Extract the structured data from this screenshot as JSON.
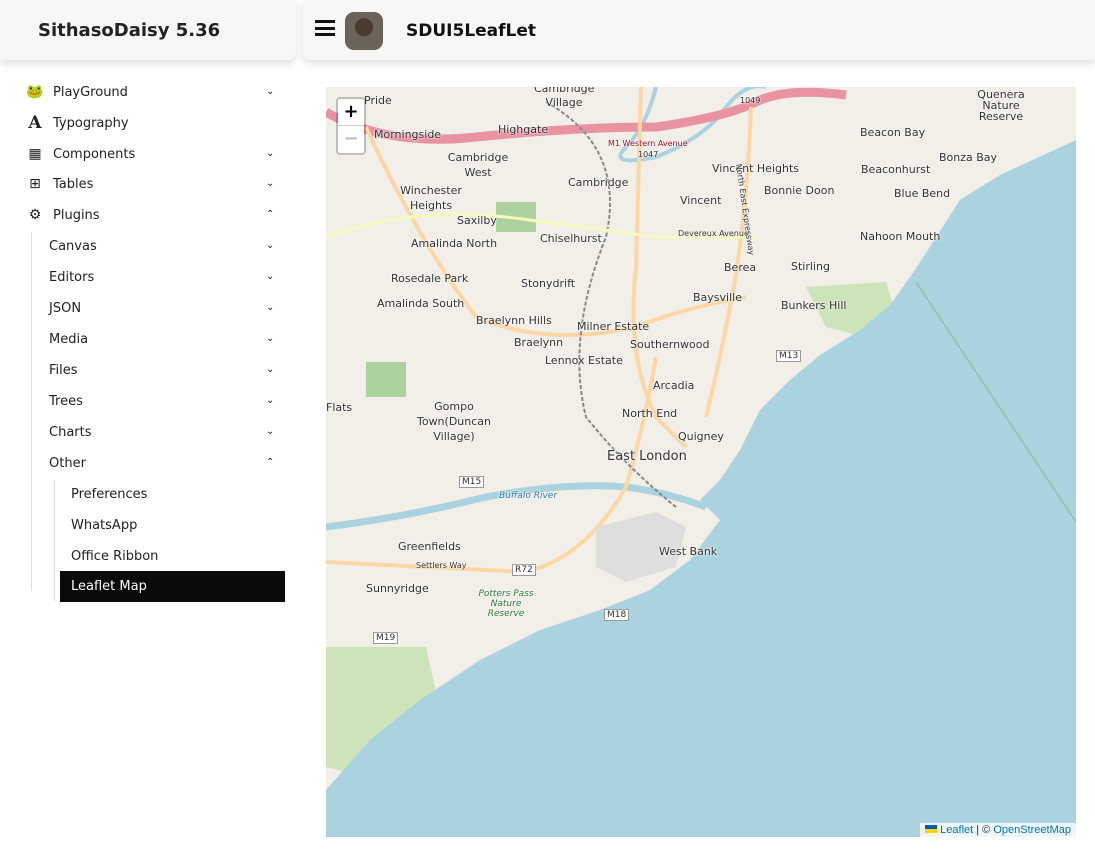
{
  "header": {
    "brand": "SithasoDaisy 5.36",
    "app_title": "SDUI5LeafLet"
  },
  "sidebar": {
    "items": [
      {
        "label": "PlayGround",
        "icon": "playground-icon"
      },
      {
        "label": "Typography",
        "icon": "typography-icon"
      },
      {
        "label": "Components",
        "icon": "gifts-icon"
      },
      {
        "label": "Tables",
        "icon": "table-icon"
      },
      {
        "label": "Plugins",
        "icon": "gears-icon"
      }
    ],
    "plugins": [
      "Canvas",
      "Editors",
      "JSON",
      "Media",
      "Files",
      "Trees",
      "Charts",
      "Other"
    ],
    "other": [
      "Preferences",
      "WhatsApp",
      "Office Ribbon",
      "Leaflet Map"
    ]
  },
  "map": {
    "zoom_in": "+",
    "zoom_out": "−",
    "attribution": {
      "leaflet": "Leaflet",
      "sep": " | © ",
      "osm": "OpenStreetMap"
    },
    "labels": {
      "pride": "Pride",
      "cambridge_village": "Cambridge Village",
      "morningside": "Morningside",
      "highgate": "Highgate",
      "m1": "M1 Western Avenue",
      "n1047": "1047",
      "n1049": "1049",
      "cambridge_west": "Cambridge West",
      "cambridge": "Cambridge",
      "vincent_heights": "Vincent Heights",
      "bonnie_doon": "Bonnie Doon",
      "beacon_bay": "Beacon Bay",
      "beaconhurst": "Beaconhurst",
      "bonza_bay": "Bonza Bay",
      "blue_bend": "Blue Bend",
      "winchester": "Winchester Heights",
      "saxilby": "Saxilby",
      "vincent": "Vincent",
      "chiselhurst": "Chiselhurst",
      "amalinda_north": "Amalinda North",
      "nahoon_mouth": "Nahoon Mouth",
      "berea": "Berea",
      "stirling": "Stirling",
      "rosedale": "Rosedale Park",
      "stonydrift": "Stonydrift",
      "baysville": "Baysville",
      "bunkers": "Bunkers Hill",
      "amalinda_south": "Amalinda South",
      "braelynn_hills": "Braelynn Hills",
      "milner": "Milner Estate",
      "braelynn": "Braelynn",
      "southernwood": "Southernwood",
      "lennox": "Lennox Estate",
      "m13": "M13",
      "arcadia": "Arcadia",
      "flats": "Flats",
      "gompo": "Gompo Town(Duncan Village)",
      "north_end": "North End",
      "quigney": "Quigney",
      "east_london": "East London",
      "m15": "M15",
      "buffalo": "Buffalo River",
      "greenfields": "Greenfields",
      "west_bank": "West Bank",
      "r72": "R72",
      "settlers": "Settlers Way",
      "sunnyridge": "Sunnyridge",
      "potters": "Potters Pass Nature Reserve",
      "m18": "M18",
      "m19": "M19",
      "quenera": "Quenera Nature Reserve",
      "devereux": "Devereux Avenue",
      "nee": "North East Expressway"
    }
  }
}
